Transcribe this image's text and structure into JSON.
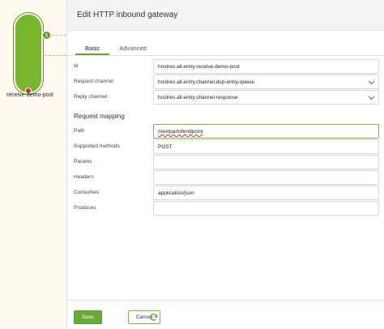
{
  "canvas": {
    "node_label": "receive-demo-post",
    "badge_text": "5"
  },
  "dialog": {
    "title": "Edit HTTP inbound gateway",
    "tabs": [
      {
        "label": "Basic",
        "active": true
      },
      {
        "label": "Advanced",
        "active": false
      }
    ],
    "fields": {
      "id": {
        "label": "Id",
        "value": "hostres.all.entry.receive.demo-post"
      },
      "request_channel": {
        "label": "Request channel",
        "value": "hostres.all.entry.channel.dsp-entry-queue"
      },
      "reply_channel": {
        "label": "Reply channel",
        "value": "hostres.all.entry.channel.response"
      },
      "path": {
        "label": "Path",
        "value": "/nextpartofendpoint"
      },
      "supported_methods": {
        "label": "Supported methods",
        "value": "POST"
      },
      "params": {
        "label": "Params",
        "value": ""
      },
      "headers": {
        "label": "Headers",
        "value": ""
      },
      "consumes": {
        "label": "Consumes",
        "value": "application/json"
      },
      "produces": {
        "label": "Produces",
        "value": ""
      }
    },
    "section_request_mapping": "Request mapping",
    "buttons": {
      "save": "Save",
      "cancel": "Cancel"
    }
  },
  "colors": {
    "accent": "#6aaa36",
    "node_fill": "#79b52e",
    "canvas_bg": "#fdf9ef"
  },
  "icons": [
    "refresh-icon",
    "chevron-down-icon"
  ]
}
